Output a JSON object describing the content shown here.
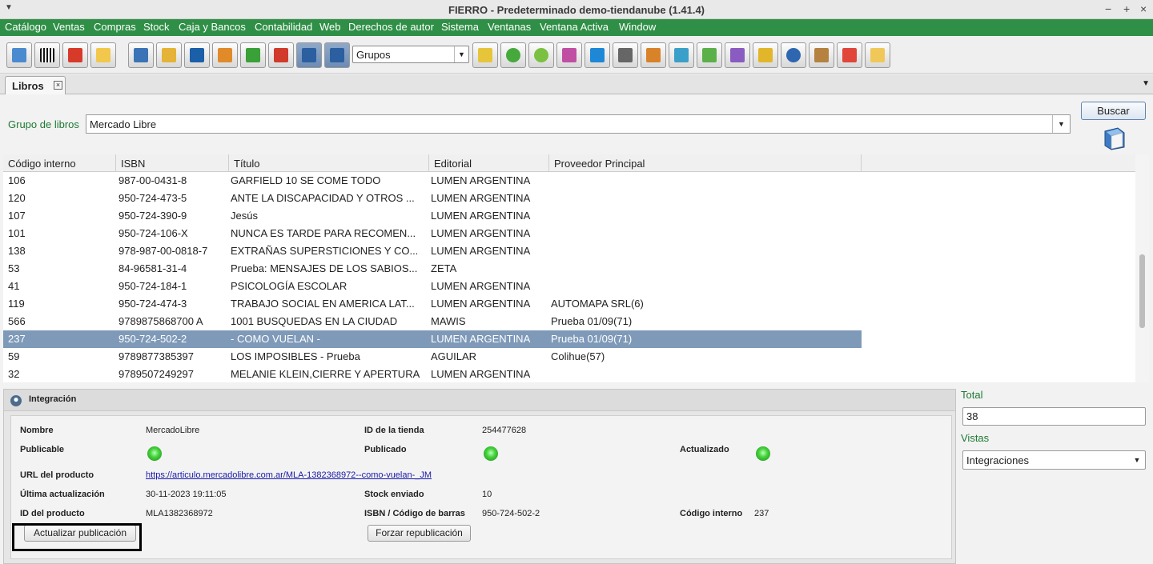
{
  "window": {
    "title": "FIERRO - Predeterminado demo-tiendanube (1.41.4)",
    "controls": [
      "−",
      "+",
      "×"
    ]
  },
  "menu": [
    "Catálogo",
    "Ventas",
    "Compras",
    "Stock",
    "Caja y Bancos",
    "Contabilidad",
    "Web",
    "Derechos de autor",
    "Sistema",
    "Ventanas",
    "Ventana Activa",
    "Window"
  ],
  "toolbar": {
    "grupos_value": "Grupos"
  },
  "tab": {
    "label": "Libros",
    "close": "×"
  },
  "filter": {
    "label": "Grupo de libros",
    "value": "Mercado Libre",
    "search_label": "Buscar"
  },
  "table": {
    "headers": [
      "Código interno",
      "ISBN",
      "Título",
      "Editorial",
      "Proveedor Principal"
    ],
    "rows": [
      [
        "106",
        "987-00-0431-8",
        "GARFIELD 10 SE COME TODO",
        "LUMEN ARGENTINA",
        ""
      ],
      [
        "120",
        "950-724-473-5",
        "ANTE LA DISCAPACIDAD Y OTROS ...",
        "LUMEN ARGENTINA",
        ""
      ],
      [
        "107",
        "950-724-390-9",
        "Jesús",
        "LUMEN ARGENTINA",
        ""
      ],
      [
        "101",
        "950-724-106-X",
        "NUNCA ES TARDE PARA RECOMEN...",
        "LUMEN ARGENTINA",
        ""
      ],
      [
        "138",
        "978-987-00-0818-7",
        "EXTRAÑAS SUPERSTICIONES Y CO...",
        "LUMEN ARGENTINA",
        ""
      ],
      [
        "53",
        "84-96581-31-4",
        "Prueba: MENSAJES DE LOS SABIOS...",
        "ZETA",
        ""
      ],
      [
        "41",
        "950-724-184-1",
        "PSICOLOGÍA ESCOLAR",
        "LUMEN ARGENTINA",
        ""
      ],
      [
        "119",
        "950-724-474-3",
        "TRABAJO SOCIAL EN AMERICA LAT...",
        "LUMEN ARGENTINA",
        "AUTOMAPA SRL(6)"
      ],
      [
        "566",
        "9789875868700 A",
        "1001 BUSQUEDAS EN LA CIUDAD",
        "MAWIS",
        "Prueba 01/09(71)"
      ],
      [
        "237",
        "950-724-502-2",
        "- COMO VUELAN -",
        "LUMEN ARGENTINA",
        "Prueba 01/09(71)"
      ],
      [
        "59",
        "9789877385397",
        "LOS IMPOSIBLES - Prueba",
        "AGUILAR",
        "Colihue(57)"
      ],
      [
        "32",
        "9789507249297",
        "MELANIE KLEIN,CIERRE Y APERTURA",
        "LUMEN ARGENTINA",
        ""
      ]
    ],
    "selected_index": 9
  },
  "integration": {
    "title": "Integración",
    "nombre_label": "Nombre",
    "nombre_value": "MercadoLibre",
    "id_tienda_label": "ID de la tienda",
    "id_tienda_value": "254477628",
    "publicable_label": "Publicable",
    "publicado_label": "Publicado",
    "actualizado_label": "Actualizado",
    "url_label": "URL del producto",
    "url_value": "https://articulo.mercadolibre.com.ar/MLA-1382368972--como-vuelan-_JM",
    "ultima_label": "Última actualización",
    "ultima_value": "30-11-2023 19:11:05",
    "stock_label": "Stock enviado",
    "stock_value": "10",
    "id_prod_label": "ID del producto",
    "id_prod_value": "MLA1382368972",
    "isbn_label": "ISBN / Código de barras",
    "isbn_value": "950-724-502-2",
    "codigo_label": "Código interno",
    "codigo_value": "237",
    "btn_actualizar": "Actualizar publicación",
    "btn_forzar": "Forzar republicación",
    "status_color": "#45d33c"
  },
  "side": {
    "total_label": "Total",
    "total_value": "38",
    "vistas_label": "Vistas",
    "vistas_value": "Integraciones"
  },
  "colors": {
    "menubar": "#2f8f46",
    "selection": "#7f9ab8",
    "label_green": "#1f7a34"
  }
}
